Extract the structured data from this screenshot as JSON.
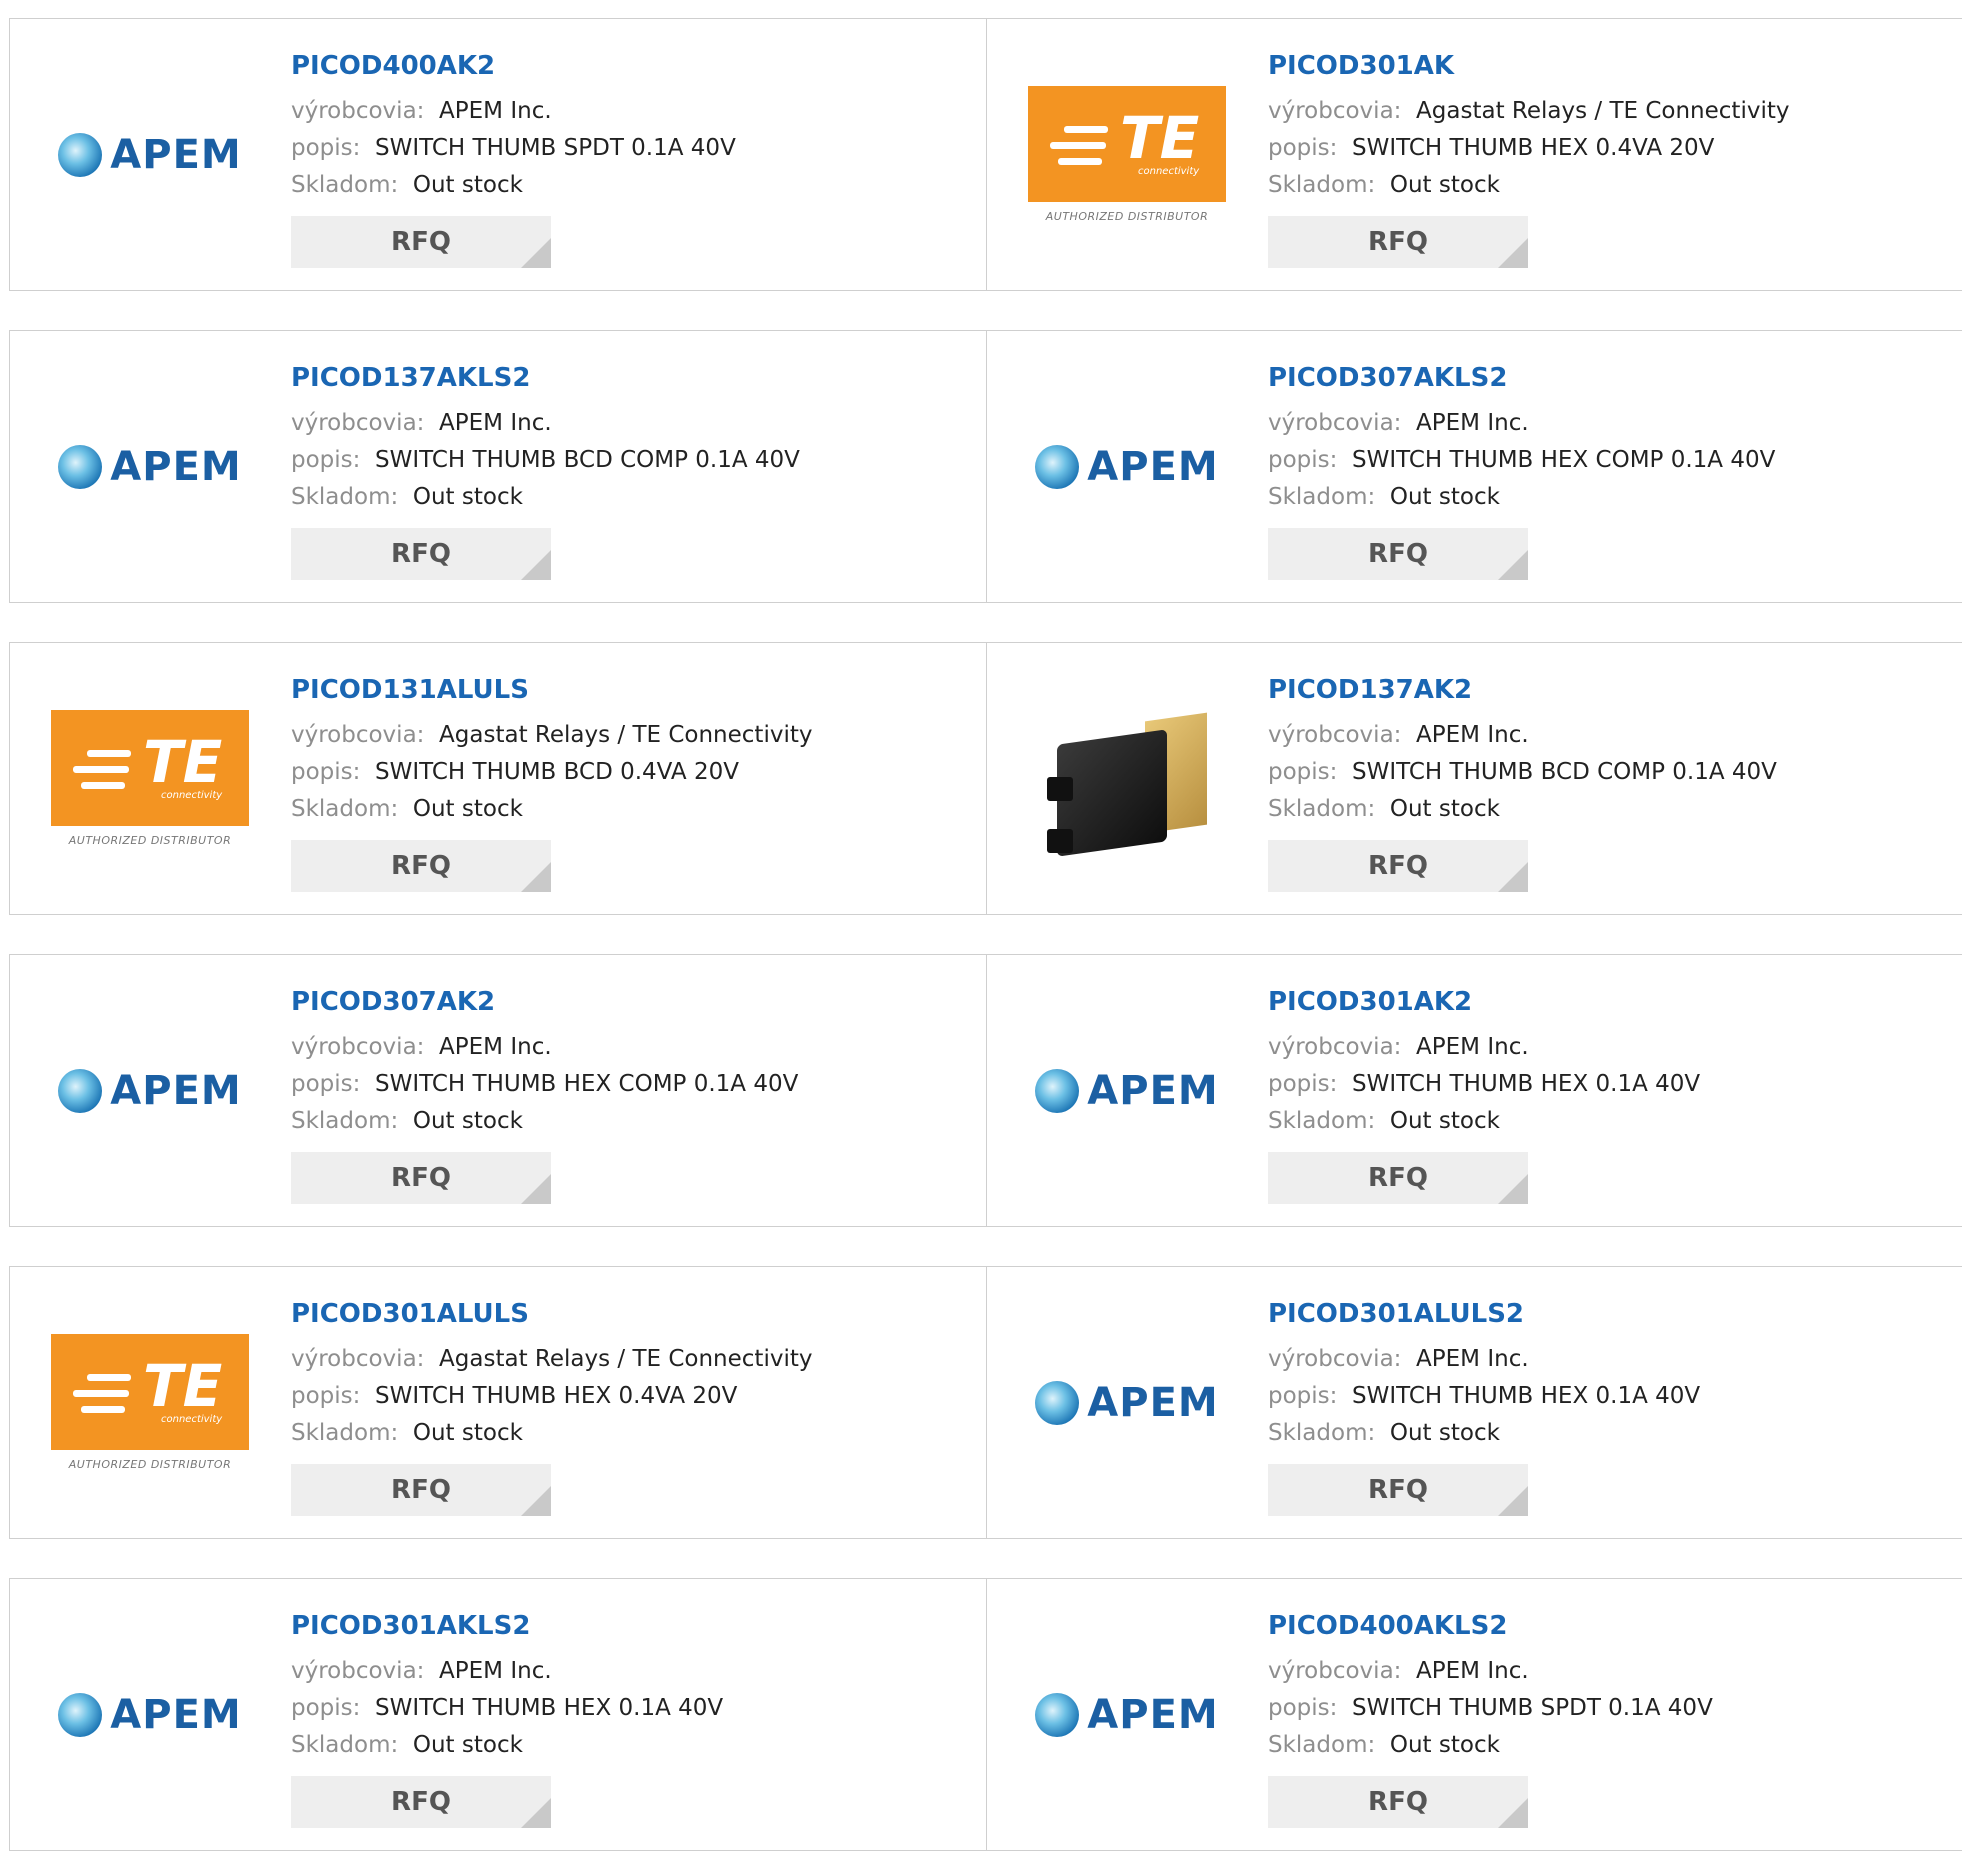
{
  "labels": {
    "manufacturer": "výrobcovia:",
    "description": "popis:",
    "stock": "Skladom:",
    "rfq": "RFQ"
  },
  "brands": {
    "apem": {
      "text": "APEM",
      "color": "#1b5fa3"
    },
    "te": {
      "text": "TE",
      "sub": "connectivity",
      "auth": "AUTHORIZED DISTRIBUTOR",
      "color": "#f39422"
    }
  },
  "products": [
    {
      "pn": "PICOD400AK2",
      "manufacturer": "APEM Inc.",
      "description": "SWITCH THUMB SPDT 0.1A 40V",
      "stock": "Out stock",
      "logo": "apem"
    },
    {
      "pn": "PICOD301AK",
      "manufacturer": "Agastat Relays / TE Connectivity",
      "description": "SWITCH THUMB HEX 0.4VA 20V",
      "stock": "Out stock",
      "logo": "te"
    },
    {
      "pn": "PICOD137AKLS2",
      "manufacturer": "APEM Inc.",
      "description": "SWITCH THUMB BCD COMP 0.1A 40V",
      "stock": "Out stock",
      "logo": "apem"
    },
    {
      "pn": "PICOD307AKLS2",
      "manufacturer": "APEM Inc.",
      "description": "SWITCH THUMB HEX COMP 0.1A 40V",
      "stock": "Out stock",
      "logo": "apem"
    },
    {
      "pn": "PICOD131ALULS",
      "manufacturer": "Agastat Relays / TE Connectivity",
      "description": "SWITCH THUMB BCD 0.4VA 20V",
      "stock": "Out stock",
      "logo": "te"
    },
    {
      "pn": "PICOD137AK2",
      "manufacturer": "APEM Inc.",
      "description": "SWITCH THUMB BCD COMP 0.1A 40V",
      "stock": "Out stock",
      "logo": "photo"
    },
    {
      "pn": "PICOD307AK2",
      "manufacturer": "APEM Inc.",
      "description": "SWITCH THUMB HEX COMP 0.1A 40V",
      "stock": "Out stock",
      "logo": "apem"
    },
    {
      "pn": "PICOD301AK2",
      "manufacturer": "APEM Inc.",
      "description": "SWITCH THUMB HEX 0.1A 40V",
      "stock": "Out stock",
      "logo": "apem"
    },
    {
      "pn": "PICOD301ALULS",
      "manufacturer": "Agastat Relays / TE Connectivity",
      "description": "SWITCH THUMB HEX 0.4VA 20V",
      "stock": "Out stock",
      "logo": "te"
    },
    {
      "pn": "PICOD301ALULS2",
      "manufacturer": "APEM Inc.",
      "description": "SWITCH THUMB HEX 0.1A 40V",
      "stock": "Out stock",
      "logo": "apem"
    },
    {
      "pn": "PICOD301AKLS2",
      "manufacturer": "APEM Inc.",
      "description": "SWITCH THUMB HEX 0.1A 40V",
      "stock": "Out stock",
      "logo": "apem"
    },
    {
      "pn": "PICOD400AKLS2",
      "manufacturer": "APEM Inc.",
      "description": "SWITCH THUMB SPDT 0.1A 40V",
      "stock": "Out stock",
      "logo": "apem"
    }
  ]
}
